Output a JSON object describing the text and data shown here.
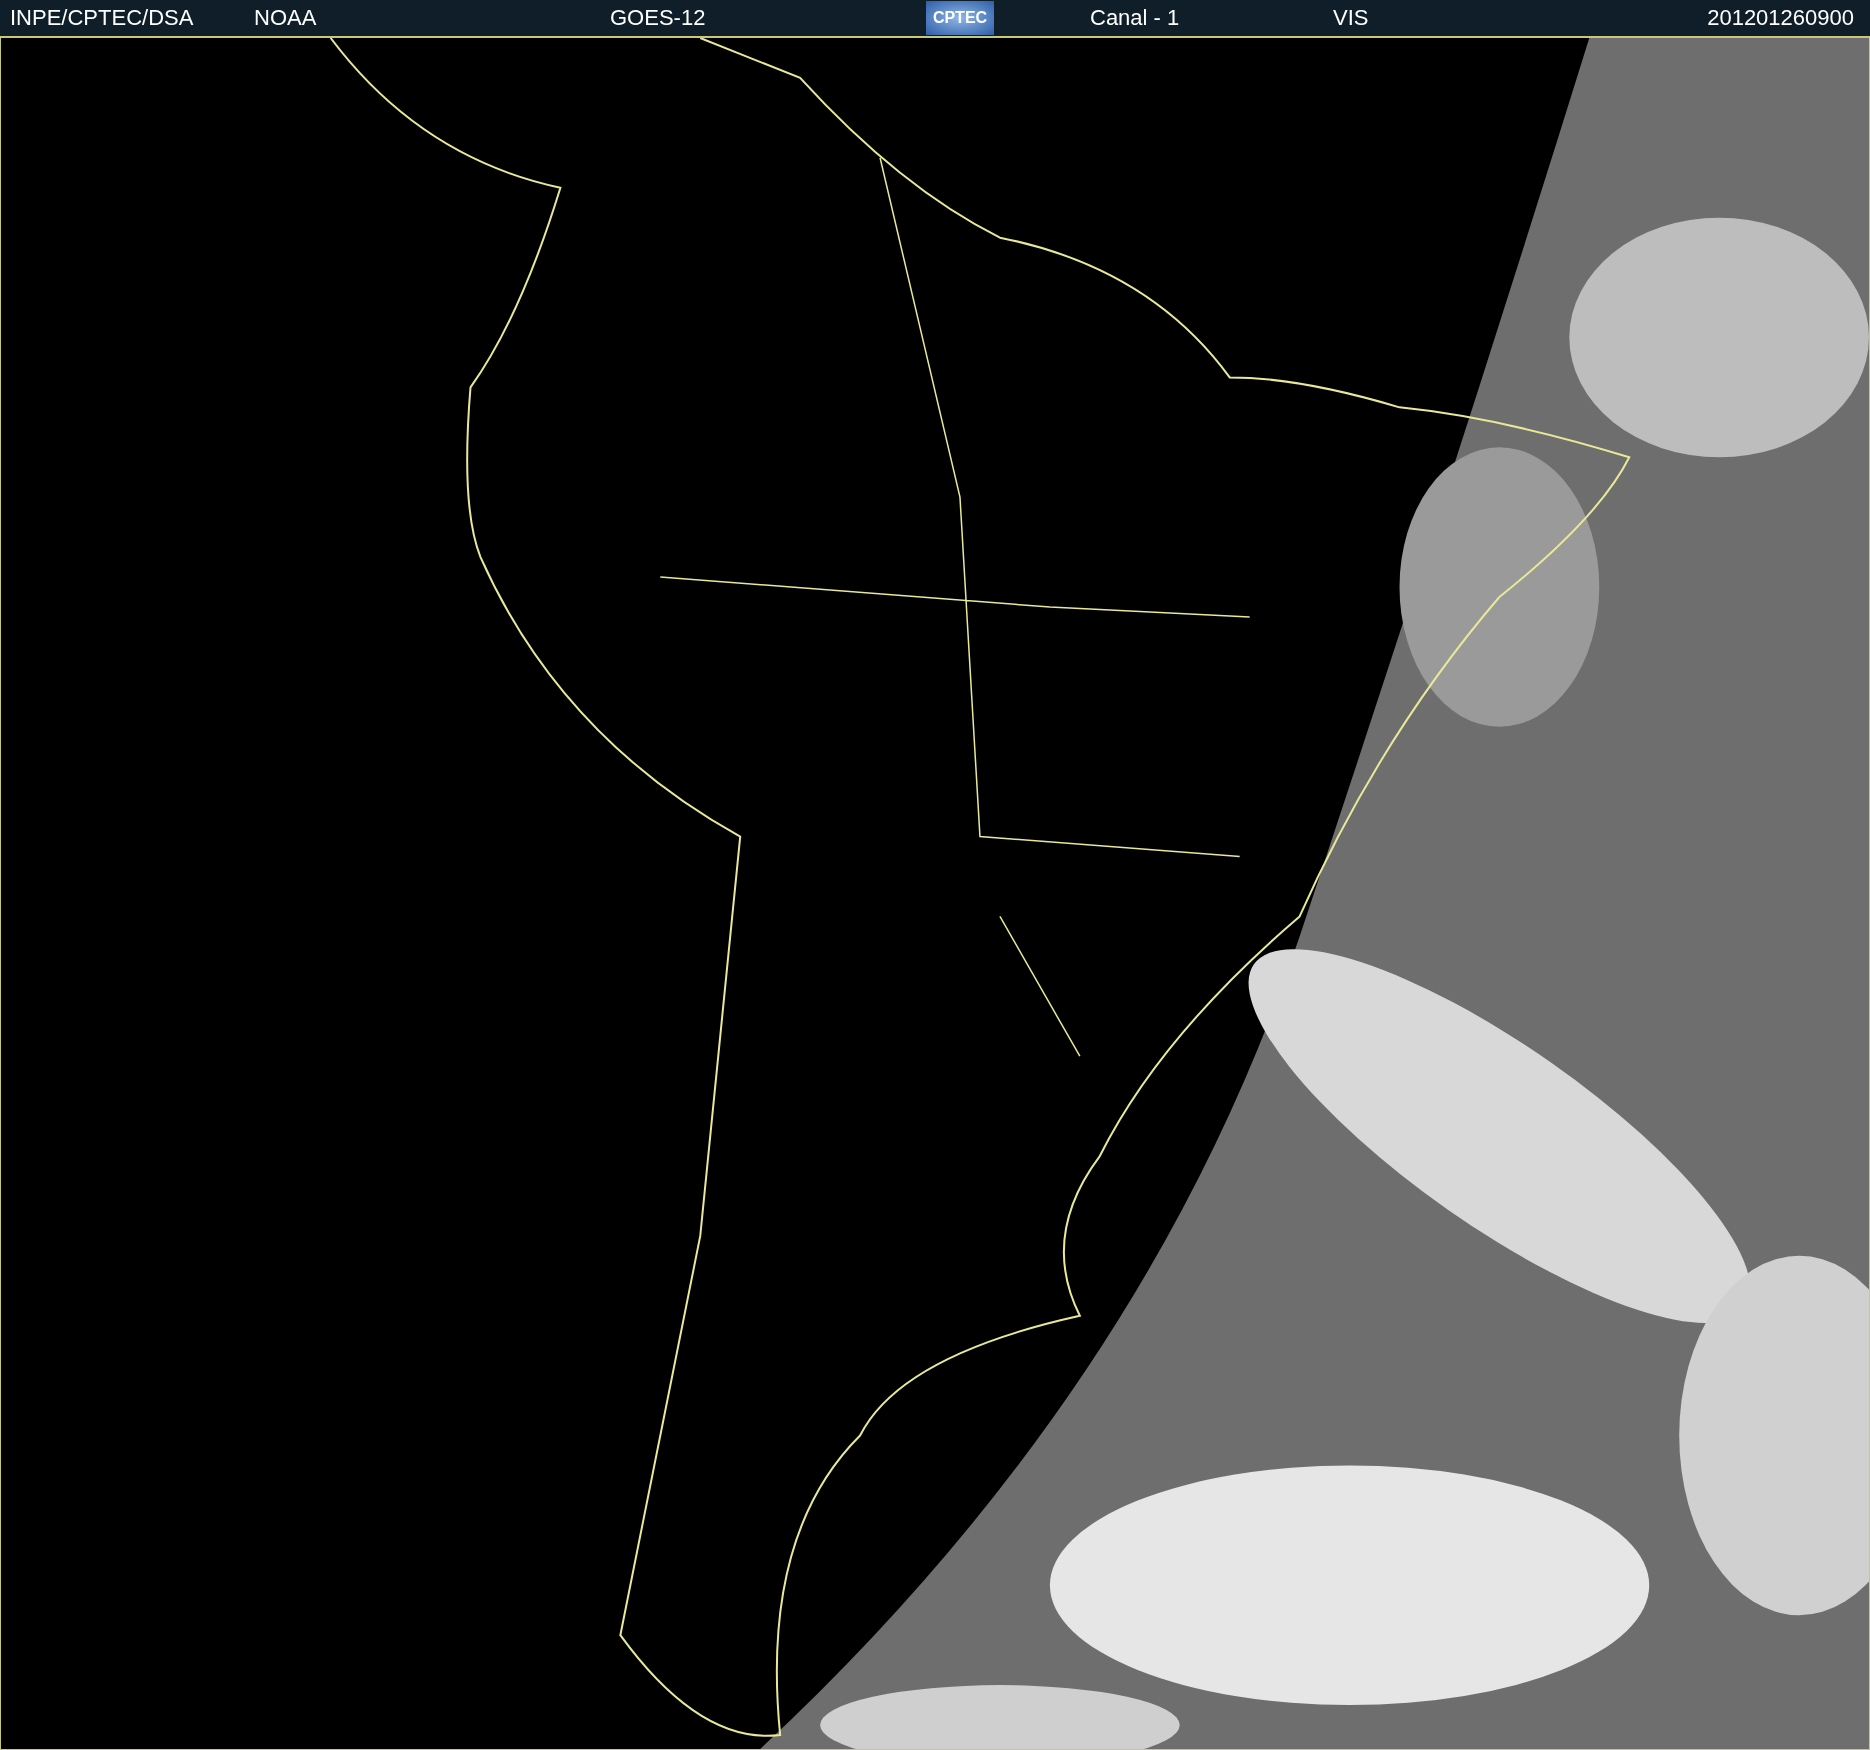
{
  "header": {
    "source": "INPE/CPTEC/DSA",
    "agency": "NOAA",
    "satellite": "GOES-12",
    "logo": {
      "text": "CPTEC"
    },
    "channel": "Canal - 1",
    "band": "VIS",
    "timestamp": "201201260900"
  }
}
